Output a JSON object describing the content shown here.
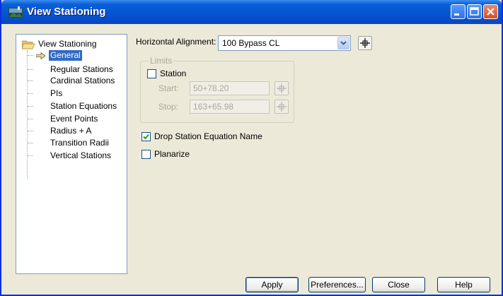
{
  "window": {
    "title": "View Stationing",
    "buttons": {
      "minimize": "minimize-icon",
      "maximize": "maximize-icon",
      "close": "close-icon"
    }
  },
  "tree": {
    "root_label": "View Stationing",
    "items": [
      {
        "label": "General",
        "selected": true
      },
      {
        "label": "Regular Stations"
      },
      {
        "label": "Cardinal Stations"
      },
      {
        "label": "PIs"
      },
      {
        "label": "Station Equations"
      },
      {
        "label": "Event Points"
      },
      {
        "label": "Radius + A"
      },
      {
        "label": "Transition Radii"
      },
      {
        "label": "Vertical Stations"
      }
    ]
  },
  "form": {
    "horizontal_alignment_label": "Horizontal Alignment:",
    "horizontal_alignment_value": "100 Bypass CL",
    "limits": {
      "legend": "Limits",
      "station_label": "Station",
      "station_checked": false,
      "start_label": "Start:",
      "start_value": "50+78.20",
      "stop_label": "Stop:",
      "stop_value": "163+65.98"
    },
    "drop_station_equation_label": "Drop Station Equation Name",
    "drop_station_equation_checked": true,
    "planarize_label": "Planarize",
    "planarize_checked": false
  },
  "footer": {
    "apply": "Apply",
    "preferences": "Preferences...",
    "close": "Close",
    "help": "Help"
  },
  "colors": {
    "titlebar": "#0553d2",
    "selection": "#316ac5",
    "dialog_bg": "#ece9d8"
  }
}
